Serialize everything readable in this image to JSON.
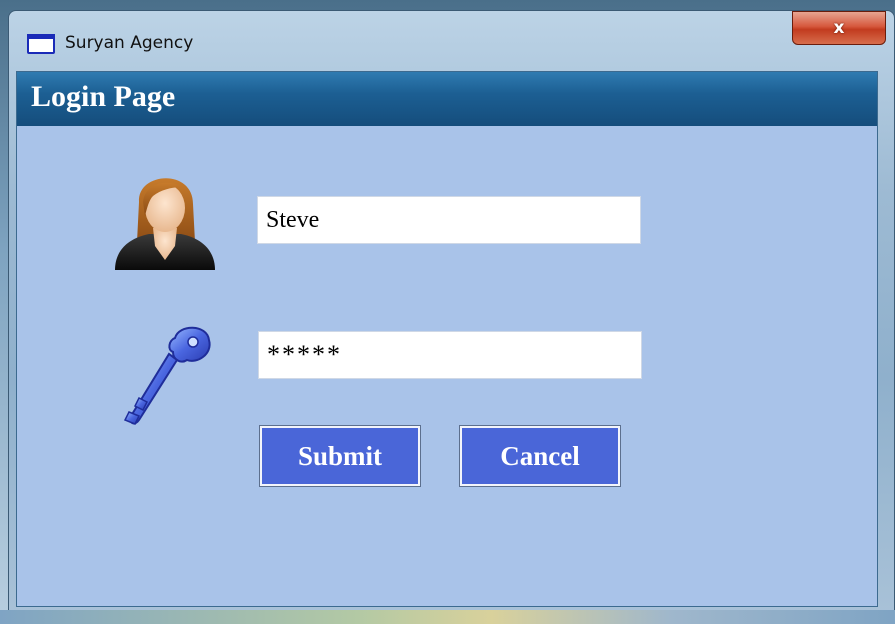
{
  "window": {
    "title": "Suryan Agency",
    "close_label": "x"
  },
  "header": {
    "title": "Login Page"
  },
  "form": {
    "username_value": "Steve",
    "password_display": "*****"
  },
  "buttons": {
    "submit_label": "Submit",
    "cancel_label": "Cancel"
  },
  "icons": {
    "user": "user-avatar-icon",
    "password": "key-icon",
    "app": "window-app-icon"
  },
  "colors": {
    "header_bar": "#1c5f93",
    "client_bg": "#a9c3e9",
    "button_bg": "#4a66d8",
    "close_button": "#c23b1f"
  }
}
